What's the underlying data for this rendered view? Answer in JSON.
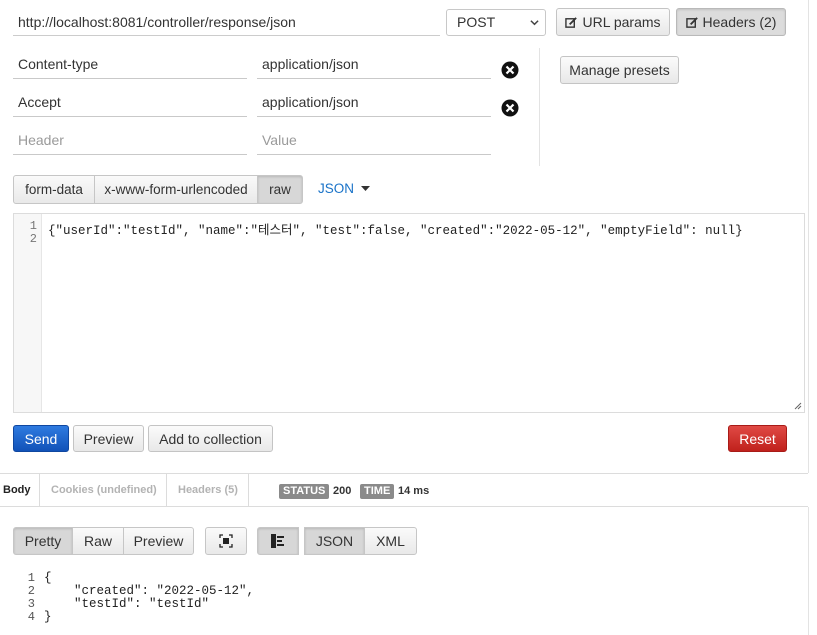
{
  "request": {
    "url": "http://localhost:8081/controller/response/json",
    "method": "POST",
    "url_params_label": "URL params",
    "headers_label": "Headers (2)"
  },
  "headers": {
    "rows": [
      {
        "key": "Content-type",
        "value": "application/json"
      },
      {
        "key": "Accept",
        "value": "application/json"
      }
    ],
    "placeholder_key": "Header",
    "placeholder_value": "Value",
    "manage_presets_label": "Manage presets"
  },
  "body_modes": {
    "tabs": [
      "form-data",
      "x-www-form-urlencoded",
      "raw"
    ],
    "active": "raw",
    "format": "JSON"
  },
  "editor": {
    "line_numbers": [
      "1",
      "2"
    ],
    "content": "{\"userId\":\"testId\", \"name\":\"테스터\", \"test\":false, \"created\":\"2022-05-12\", \"emptyField\": null}"
  },
  "actions": {
    "send": "Send",
    "preview": "Preview",
    "add_to_collection": "Add to collection",
    "reset": "Reset"
  },
  "response": {
    "tabs": [
      "Body",
      "Cookies (undefined)",
      "Headers (5)"
    ],
    "status_label": "STATUS",
    "status_value": "200",
    "time_label": "TIME",
    "time_value": "14 ms",
    "view_tabs": [
      "Pretty",
      "Raw",
      "Preview"
    ],
    "format_tabs": [
      "JSON",
      "XML"
    ],
    "line_numbers": [
      "1",
      "2",
      "3",
      "4"
    ],
    "lines": [
      "{",
      "    \"created\": \"2022-05-12\",",
      "    \"testId\": \"testId\"",
      "}"
    ]
  },
  "colors": {
    "send": "#1a5fcc",
    "reset": "#d0302b",
    "link": "#1a73c8",
    "badge": "#8a8a8a"
  },
  "icons": [
    "edit-icon",
    "remove-icon",
    "caret-down-icon",
    "resize-handle-icon",
    "fullscreen-icon",
    "wrap-icon"
  ]
}
